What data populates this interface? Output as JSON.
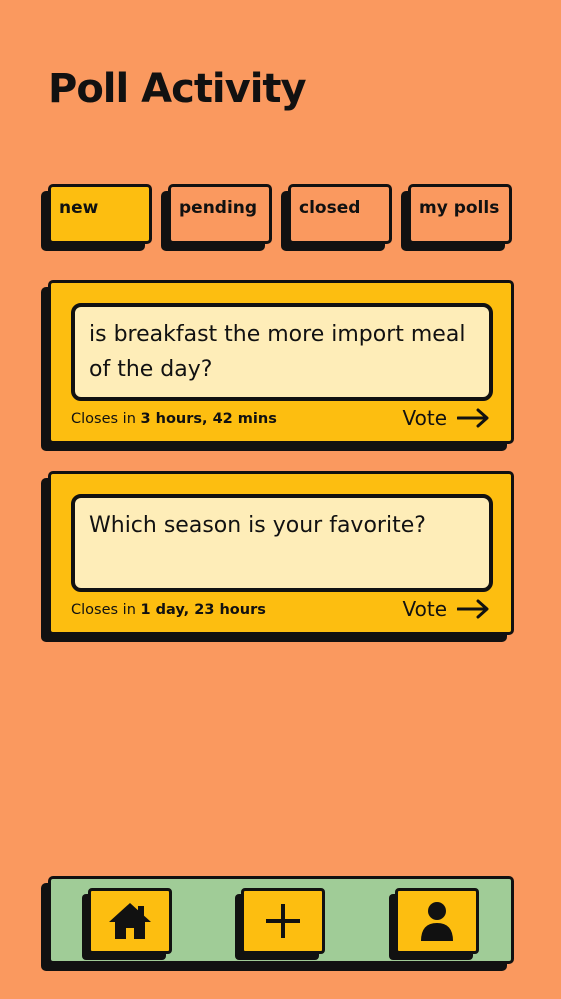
{
  "header": {
    "title": "Poll Activity"
  },
  "tabs": [
    {
      "label": "new",
      "active": true
    },
    {
      "label": "pending",
      "active": false
    },
    {
      "label": "closed",
      "active": false
    },
    {
      "label": "my polls",
      "active": false
    }
  ],
  "polls": [
    {
      "question": "is breakfast the more import meal of the day?",
      "closes_prefix": "Closes in",
      "closes_time": "3 hours, 42 mins",
      "vote_label": "Vote"
    },
    {
      "question": "Which season is your favorite?",
      "closes_prefix": "Closes in",
      "closes_time": "1 day, 23 hours",
      "vote_label": "Vote"
    }
  ],
  "nav": {
    "items": [
      {
        "icon": "home-icon"
      },
      {
        "icon": "plus-icon"
      },
      {
        "icon": "user-icon"
      }
    ]
  },
  "colors": {
    "background": "#FA995F",
    "accent": "#FDBE10",
    "question_bg": "#FEEDB8",
    "nav_bg": "#A0CC97",
    "ink": "#111111"
  }
}
